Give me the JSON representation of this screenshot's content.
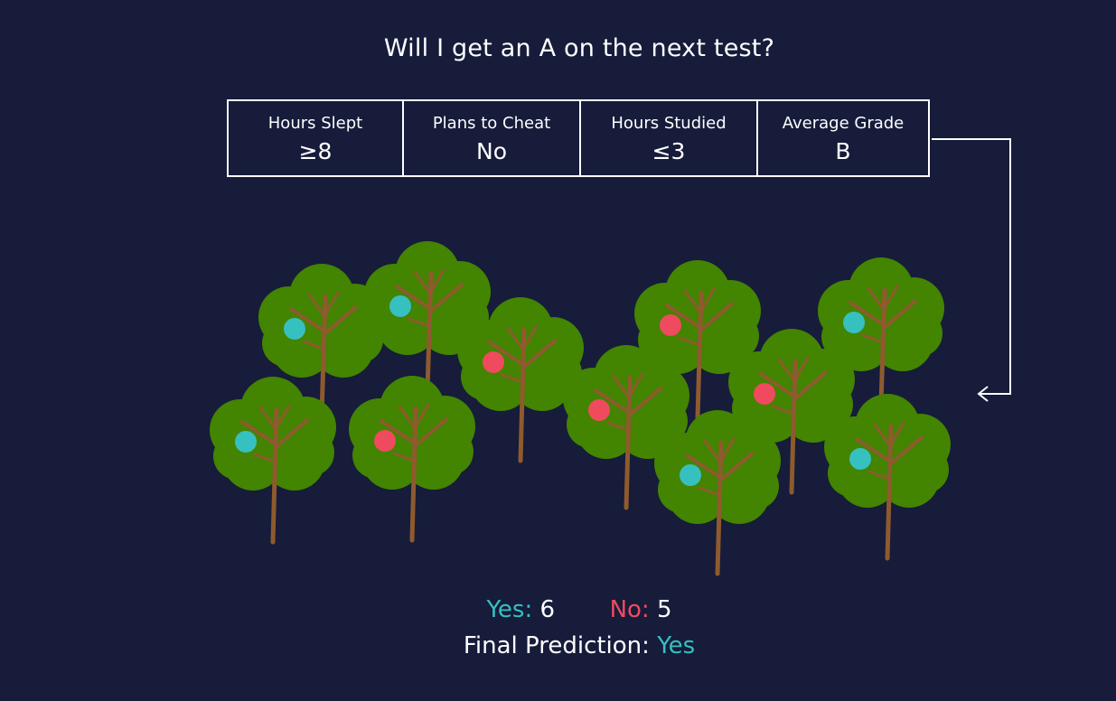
{
  "title": "Will I get an A on the next test?",
  "features": [
    {
      "label": "Hours Slept",
      "value": "≥8"
    },
    {
      "label": "Plans to Cheat",
      "value": "No"
    },
    {
      "label": "Hours Studied",
      "value": "≤3"
    },
    {
      "label": "Average Grade",
      "value": "B"
    }
  ],
  "votes": {
    "yes_label": "Yes:",
    "yes_count": "6",
    "no_label": "No:",
    "no_count": "5"
  },
  "final": {
    "label": "Final Prediction:",
    "value": "Yes"
  },
  "colors": {
    "background": "#161c3a",
    "yes": "#36c0c0",
    "no": "#f04a5e",
    "foliage": "#438400",
    "trunk": "#8e5a2e"
  },
  "trees": [
    {
      "vote": "yes"
    },
    {
      "vote": "yes"
    },
    {
      "vote": "no"
    },
    {
      "vote": "yes"
    },
    {
      "vote": "no"
    },
    {
      "vote": "no"
    },
    {
      "vote": "yes"
    },
    {
      "vote": "no"
    },
    {
      "vote": "no"
    },
    {
      "vote": "yes"
    },
    {
      "vote": "yes"
    }
  ]
}
